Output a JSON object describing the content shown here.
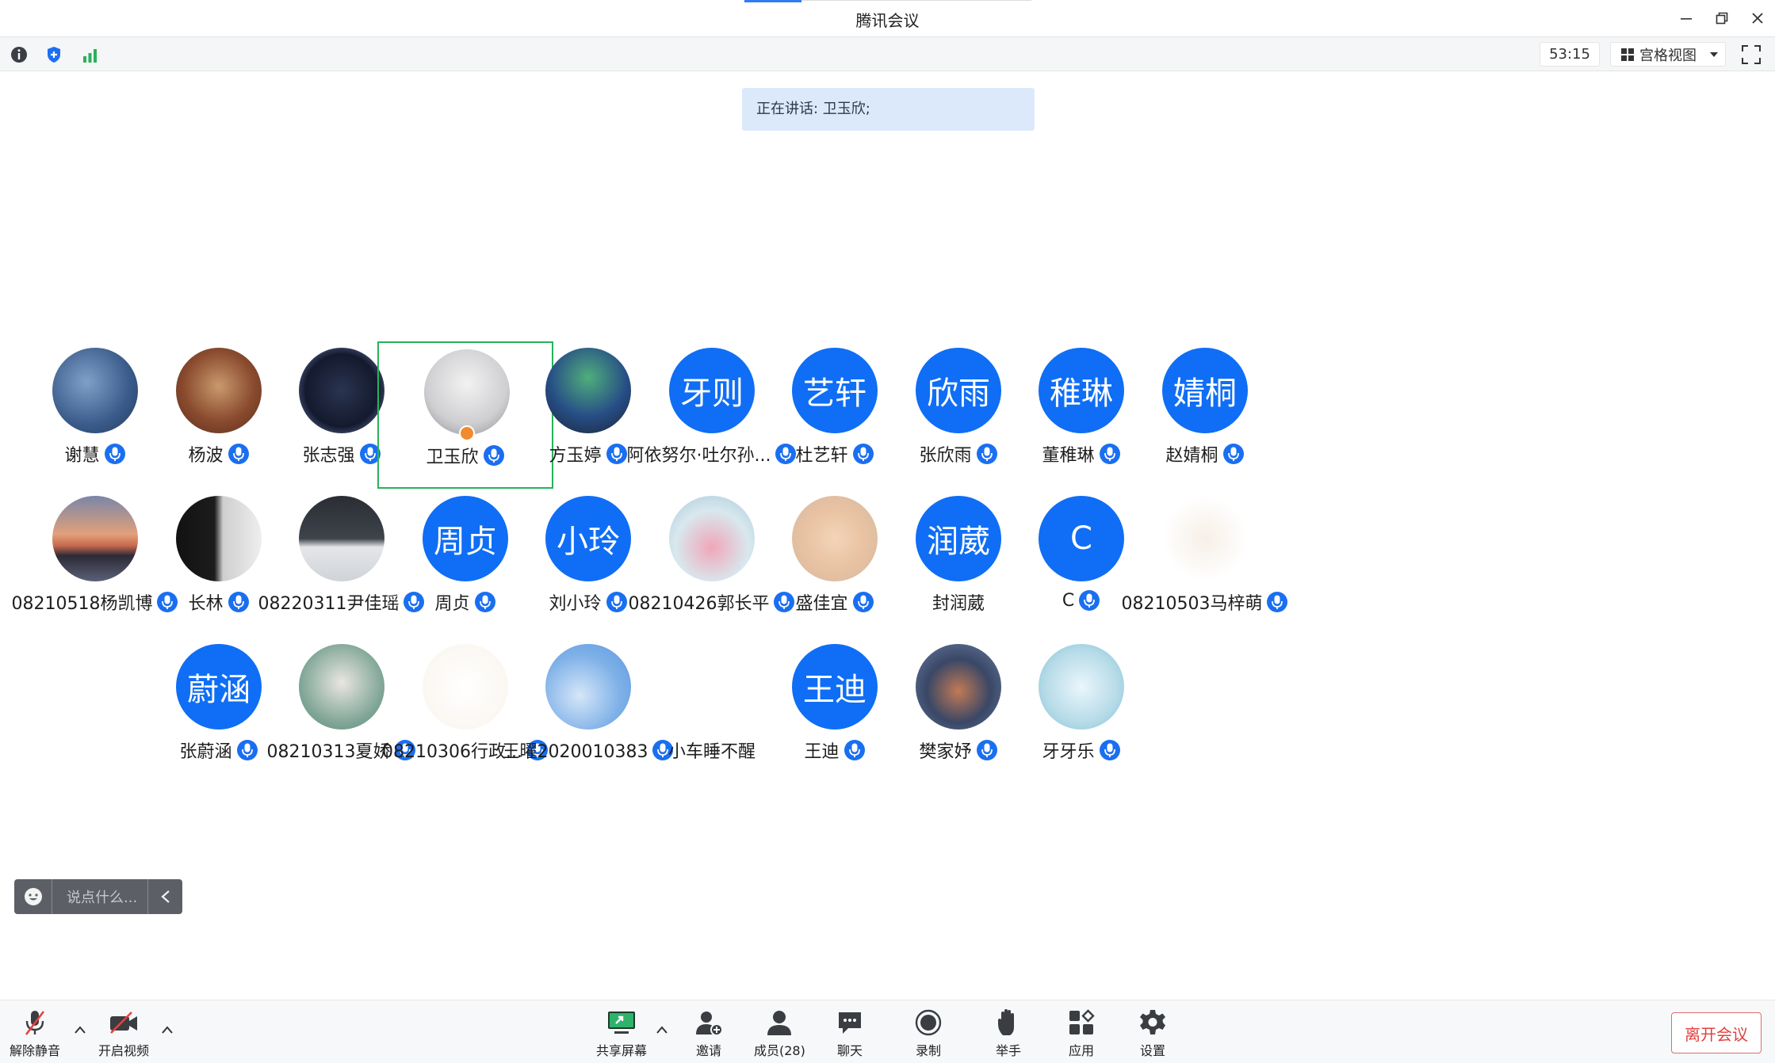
{
  "window": {
    "title": "腾讯会议"
  },
  "toolbar": {
    "timer": "53:15",
    "view_label": "宫格视图"
  },
  "speaking": {
    "text": "正在讲话: 卫玉欣;"
  },
  "colors": {
    "accent": "#0f6ef5",
    "active_border": "#27b25b",
    "leave": "#e0413f"
  },
  "participants": [
    {
      "name": "谢慧",
      "avatar_text": "",
      "photo": "illustration"
    },
    {
      "name": "杨波",
      "avatar_text": "",
      "photo": "portrait"
    },
    {
      "name": "张志强",
      "avatar_text": "",
      "photo": "dark-figure"
    },
    {
      "name": "卫玉欣",
      "avatar_text": "",
      "photo": "girl-drawing",
      "active": true
    },
    {
      "name": "方玉婷",
      "avatar_text": "",
      "photo": "anime"
    },
    {
      "name": "阿依努尔·吐尔孙...",
      "avatar_text": "牙则"
    },
    {
      "name": "杜艺轩",
      "avatar_text": "艺轩"
    },
    {
      "name": "张欣雨",
      "avatar_text": "欣雨"
    },
    {
      "name": "董稚琳",
      "avatar_text": "稚琳"
    },
    {
      "name": "赵婧桐",
      "avatar_text": "婧桐"
    },
    {
      "name": "08210518杨凯博",
      "avatar_text": "",
      "photo": "sunset"
    },
    {
      "name": "长林",
      "avatar_text": "",
      "photo": "cat"
    },
    {
      "name": "08220311尹佳瑶",
      "avatar_text": "",
      "photo": "dark-collage"
    },
    {
      "name": "周贞",
      "avatar_text": "周贞"
    },
    {
      "name": "刘小玲",
      "avatar_text": "小玲"
    },
    {
      "name": "08210426郭长平",
      "avatar_text": "",
      "photo": "lotus"
    },
    {
      "name": "盛佳宜",
      "avatar_text": "",
      "photo": "girl-grid"
    },
    {
      "name": "封润葳",
      "avatar_text": "润葳",
      "no_mic": true
    },
    {
      "name": "C",
      "avatar_text": "C"
    },
    {
      "name": "08210503马梓萌",
      "avatar_text": "",
      "photo": "figure-light"
    },
    {
      "name": "张蔚涵",
      "avatar_text": "蔚涵"
    },
    {
      "name": "08210313夏娇",
      "avatar_text": "",
      "photo": "girl-sitting"
    },
    {
      "name": "08210306行政...",
      "avatar_text": "",
      "photo": "sheep-sketch"
    },
    {
      "name": "王曜2020010383",
      "avatar_text": "",
      "photo": "blue-bear"
    },
    {
      "name": "小车睡不醒",
      "avatar_text": "",
      "photo": "tiny-sketch",
      "no_mic": true
    },
    {
      "name": "王迪",
      "avatar_text": "王迪"
    },
    {
      "name": "樊家妤",
      "avatar_text": "",
      "photo": "clouds"
    },
    {
      "name": "牙牙乐",
      "avatar_text": "",
      "photo": "cartoon-cat"
    }
  ],
  "chat": {
    "placeholder": "说点什么..."
  },
  "bottom": {
    "unmute": "解除静音",
    "video": "开启视频",
    "share": "共享屏幕",
    "invite": "邀请",
    "members": "成员(28)",
    "chat": "聊天",
    "record": "录制",
    "raise_hand": "举手",
    "apps": "应用",
    "settings": "设置",
    "leave": "离开会议"
  }
}
